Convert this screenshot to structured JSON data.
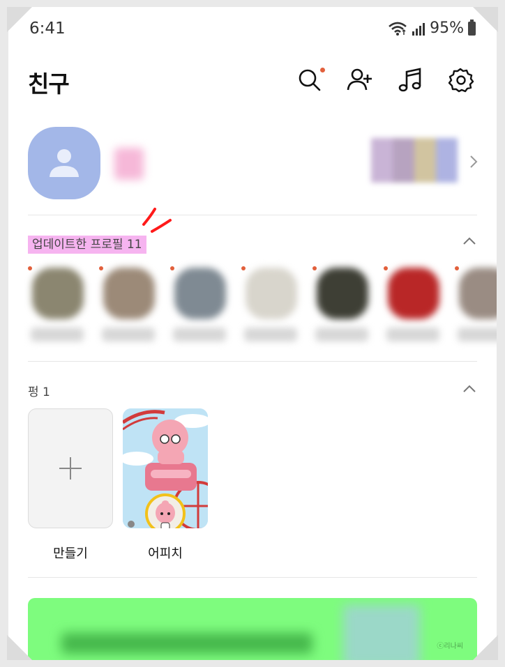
{
  "status_bar": {
    "time": "6:41",
    "battery": "95%"
  },
  "header": {
    "title": "친구"
  },
  "updated_profiles": {
    "label": "업데이트한 프로필 11"
  },
  "pung": {
    "label": "펑 1",
    "create_label": "만들기",
    "item_label": "어피치"
  },
  "watermark": "ⓒ리나씨",
  "colors": {
    "accent_dot": "#e2603c",
    "highlight": "#f6b4f0",
    "avatar_bg": "#a3b7e8",
    "banner_bg": "#7efc7e"
  },
  "icons": [
    "search-icon",
    "add-friend-icon",
    "music-icon",
    "settings-icon",
    "person-icon",
    "chevron-right-icon",
    "chevron-up-icon",
    "plus-icon",
    "wifi-icon",
    "signal-icon",
    "battery-icon"
  ]
}
